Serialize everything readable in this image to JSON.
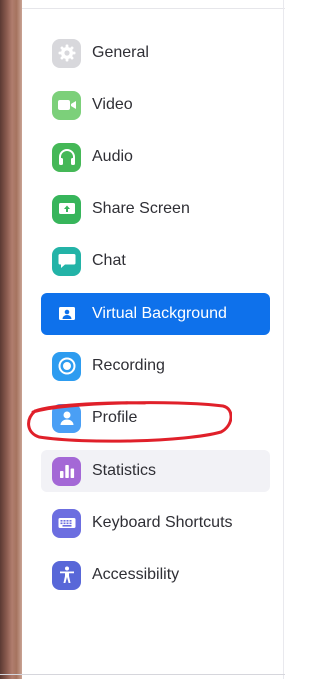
{
  "settings_menu": {
    "items": [
      {
        "label": "General",
        "icon": "gear-icon",
        "color": "#9b9ba3"
      },
      {
        "label": "Video",
        "icon": "video-camera-icon",
        "color": "#5fc460"
      },
      {
        "label": "Audio",
        "icon": "headphones-icon",
        "color": "#34b34f"
      },
      {
        "label": "Share Screen",
        "icon": "share-screen-icon",
        "color": "#37b55b"
      },
      {
        "label": "Chat",
        "icon": "chat-bubble-icon",
        "color": "#23b3a7"
      },
      {
        "label": "Virtual Background",
        "icon": "virtual-background-icon",
        "color": "#0e71eb",
        "selected": true
      },
      {
        "label": "Recording",
        "icon": "record-icon",
        "color": "#2d9cf0"
      },
      {
        "label": "Profile",
        "icon": "user-icon",
        "color": "#4a9ff5",
        "annotated": true
      },
      {
        "label": "Statistics",
        "icon": "bar-chart-icon",
        "color": "#a468d6"
      },
      {
        "label": "Keyboard Shortcuts",
        "icon": "keyboard-icon",
        "color": "#6c6ee0"
      },
      {
        "label": "Accessibility",
        "icon": "accessibility-icon",
        "color": "#5867d8"
      }
    ]
  },
  "colors": {
    "active_bg": "#0e71eb",
    "hover_bg": "#f2f2f6",
    "annotation_stroke": "#e0202a"
  }
}
